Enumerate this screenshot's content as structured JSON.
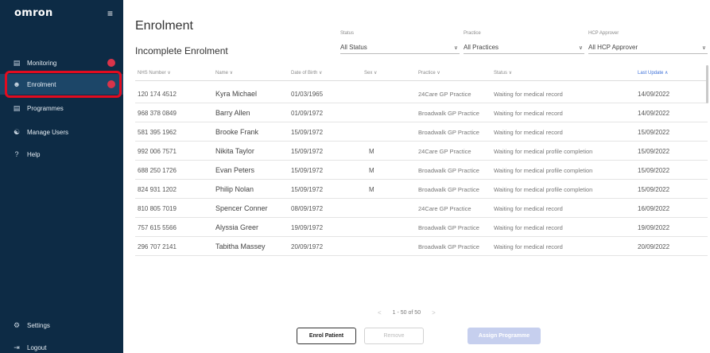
{
  "sidebar": {
    "logo": "omron",
    "menu_icon": "hamburger-icon",
    "items": [
      {
        "key": "monitoring",
        "label": "Monitoring",
        "icon": "monitor-icon",
        "has_badge": true
      },
      {
        "key": "enrolment",
        "label": "Enrolment",
        "icon": "person-add-icon",
        "has_badge": true
      },
      {
        "key": "programmes",
        "label": "Programmes",
        "icon": "clipboard-icon",
        "has_badge": false
      },
      {
        "key": "manage-users",
        "label": "Manage Users",
        "icon": "users-icon",
        "has_badge": false
      },
      {
        "key": "help",
        "label": "Help",
        "icon": "question-icon",
        "has_badge": false
      }
    ],
    "bottom_items": [
      {
        "key": "settings",
        "label": "Settings",
        "icon": "gear-icon"
      },
      {
        "key": "logout",
        "label": "Logout",
        "icon": "logout-icon"
      }
    ],
    "colors": {
      "background": "#0d2b45",
      "active": "#1c4668",
      "badge": "#d9344a",
      "highlight_outline": "#e30b1f"
    }
  },
  "main": {
    "page_title": "Enrolment",
    "section_title": "Incomplete Enrolment",
    "filters": {
      "status": {
        "label": "Status",
        "value": "All Status"
      },
      "practice": {
        "label": "Practice",
        "value": "All Practices"
      },
      "hcp": {
        "label": "HCP Approver",
        "value": "All HCP Approver"
      }
    },
    "columns": [
      "NHS Number ∨",
      "Name ∨",
      "Date of Birth ∨",
      "Sex ∨",
      "Practice ∨",
      "Status ∨",
      "Last Update ∧"
    ],
    "rows": [
      {
        "nhs": "120 174 4512",
        "name": "Kyra Michael",
        "dob": "01/03/1965",
        "sex": "",
        "practice": "24Care GP Practice",
        "status": "Waiting for medical record",
        "updated": "14/09/2022"
      },
      {
        "nhs": "968 378 0849",
        "name": "Barry Allen",
        "dob": "01/09/1972",
        "sex": "",
        "practice": "Broadwalk GP Practice",
        "status": "Waiting for medical record",
        "updated": "14/09/2022"
      },
      {
        "nhs": "581 395 1962",
        "name": "Brooke Frank",
        "dob": "15/09/1972",
        "sex": "",
        "practice": "Broadwalk GP Practice",
        "status": "Waiting for medical record",
        "updated": "15/09/2022"
      },
      {
        "nhs": "992 006 7571",
        "name": "Nikita Taylor",
        "dob": "15/09/1972",
        "sex": "M",
        "practice": "24Care GP Practice",
        "status": "Waiting for medical profile completion",
        "updated": "15/09/2022"
      },
      {
        "nhs": "688 250 1726",
        "name": "Evan Peters",
        "dob": "15/09/1972",
        "sex": "M",
        "practice": "Broadwalk GP Practice",
        "status": "Waiting for medical profile completion",
        "updated": "15/09/2022"
      },
      {
        "nhs": "824 931 1202",
        "name": "Philip Nolan",
        "dob": "15/09/1972",
        "sex": "M",
        "practice": "Broadwalk GP Practice",
        "status": "Waiting for medical profile completion",
        "updated": "15/09/2022"
      },
      {
        "nhs": "810 805 7019",
        "name": "Spencer Conner",
        "dob": "08/09/1972",
        "sex": "",
        "practice": "24Care GP Practice",
        "status": "Waiting for medical record",
        "updated": "16/09/2022"
      },
      {
        "nhs": "757 615 5566",
        "name": "Alyssia Greer",
        "dob": "19/09/1972",
        "sex": "",
        "practice": "Broadwalk GP Practice",
        "status": "Waiting for medical record",
        "updated": "19/09/2022"
      },
      {
        "nhs": "296 707 2141",
        "name": "Tabitha Massey",
        "dob": "20/09/1972",
        "sex": "",
        "practice": "Broadwalk GP Practice",
        "status": "Waiting for medical record",
        "updated": "20/09/2022"
      }
    ],
    "pagination": {
      "text": "1 - 50 of 50",
      "prev": "<",
      "next": ">"
    },
    "buttons": {
      "enrol": "Enrol Patient",
      "remove": "Remove",
      "assign": "Assign Programme"
    },
    "colors": {
      "sort_active": "#3b6fd8",
      "assign_disabled": "#c6cfee"
    }
  }
}
